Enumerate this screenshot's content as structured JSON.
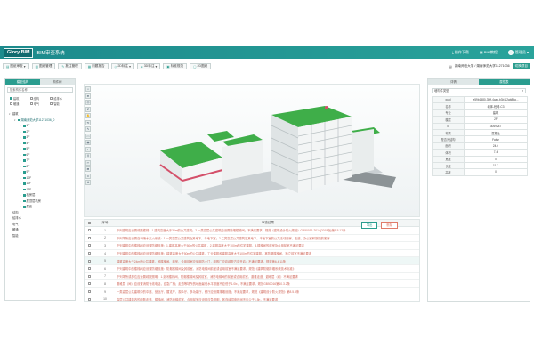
{
  "header": {
    "logo": "Glory BIM",
    "app_name": "BIM审查系统",
    "right_items": [
      "操作下载",
      "BIM教程"
    ],
    "user": "管理员"
  },
  "toolbar": {
    "buttons": [
      {
        "label": "图纸审查",
        "icon": "doc-icon"
      },
      {
        "label": "图纸管理",
        "icon": "folder-icon"
      },
      {
        "label": "批注管理",
        "icon": "note-icon"
      },
      {
        "label": "问题报告",
        "icon": "report-icon"
      },
      {
        "label": "2D标注",
        "icon": "mark-icon"
      },
      {
        "label": "3D标注",
        "icon": "cube-icon"
      },
      {
        "label": "标准规范",
        "icon": "book-icon"
      },
      {
        "label": "2D图纸",
        "icon": "sheet-icon"
      }
    ],
    "project_name": "湖南师范大学 / 湖南师范大学11271036",
    "switch_label": "切换项目"
  },
  "left_panel": {
    "tabs": [
      "模型结构",
      "构件树"
    ],
    "search_placeholder": "搜索构件名称",
    "filters": [
      "建筑",
      "结构",
      "给排水",
      "暖通",
      "电气",
      "智能"
    ],
    "tree": [
      {
        "label": "建筑",
        "level": 0,
        "expand": "▾"
      },
      {
        "label": "湖南师范大学11271036_0",
        "level": 1,
        "expand": "▾",
        "selected": true
      },
      {
        "label": "1F",
        "level": 2,
        "expand": "▸"
      },
      {
        "label": "2F",
        "level": 2,
        "expand": "▸"
      },
      {
        "label": "3F",
        "level": 2,
        "expand": "▸"
      },
      {
        "label": "4F",
        "level": 2,
        "expand": "▸"
      },
      {
        "label": "5F",
        "level": 2,
        "expand": "▸"
      },
      {
        "label": "6F",
        "level": 2,
        "expand": "▸"
      },
      {
        "label": "7F",
        "level": 2,
        "expand": "▸"
      },
      {
        "label": "8F",
        "level": 2,
        "expand": "▸"
      },
      {
        "label": "9F",
        "level": 2,
        "expand": "▸"
      },
      {
        "label": "10F",
        "level": 2,
        "expand": "▸"
      },
      {
        "label": "11F",
        "level": 2,
        "expand": "▸"
      },
      {
        "label": "12F",
        "level": 2,
        "expand": "▸"
      },
      {
        "label": "机房层",
        "level": 2,
        "expand": "▸"
      },
      {
        "label": "屋顶层机房",
        "level": 2,
        "expand": "▸"
      },
      {
        "label": "屋面",
        "level": 2,
        "expand": "▸"
      },
      {
        "label": "结构",
        "level": 0,
        "expand": ""
      },
      {
        "label": "给排水",
        "level": 0,
        "expand": ""
      },
      {
        "label": "电气",
        "level": 0,
        "expand": ""
      },
      {
        "label": "暖通",
        "level": 0,
        "expand": ""
      },
      {
        "label": "智能",
        "level": 0,
        "expand": ""
      }
    ]
  },
  "viewport": {
    "tools": [
      "⌂",
      "⊕",
      "◎",
      "Z",
      "✋",
      "⟲",
      "✎",
      "▭",
      "▦",
      "◐",
      "⚲",
      "✂",
      "⊞",
      "≡",
      "⚙"
    ]
  },
  "issues": {
    "col_index": "序号",
    "col_desc": "审查结果",
    "btn_export": "导出",
    "btn_delete": "删除",
    "rows": [
      {
        "num": "1",
        "desc": "下列建筑应设置疏散楼梯：1.建筑高度大于32m的公共建筑；2.一类高层公共建筑应设置防烟楼梯间；不满足要求，规范《建筑设计防火规范》GB50016-2014(2018版)第5.5.12条",
        "hl": false
      },
      {
        "num": "2",
        "desc": "下列场所应设置自动喷水灭火系统：1.一类高层公共建筑及其地下、半地下室；2.二类高层公共建筑及其地下、半地下室的公共活动用房、走道、办公室和旅馆的客房",
        "hl": false
      },
      {
        "num": "3",
        "desc": "下列建筑中的楼梯间应设置防烟设施：1.建筑高度大于50m的公共建筑，2.建筑高度大于100m的住宅建筑，3.楼梯间的前室及合用前室不满足要求",
        "hl": false
      },
      {
        "num": "4",
        "desc": "下列建筑中的楼梯间应设置防烟设施：建筑高度大于50m的公共建筑、工业建筑和建筑高度大于100m的住宅建筑，其防烟楼梯间、独立前室不满足要求",
        "hl": false
      },
      {
        "num": "5",
        "desc": "建筑高度大于24m的公共建筑，其楼梯间、前室、合用前室应采用防火门，疏散门应向疏散方向开启；不满足要求，规范第6.4.11条",
        "hl": true
      },
      {
        "num": "6",
        "desc": "下列建筑中的楼梯间应设置防烟设施：防烟楼梯间及其前室、消防电梯间前室或合用前室不满足要求，规范《建筑防烟排烟系统技术标准》",
        "hl": false
      },
      {
        "num": "7",
        "desc": "下列场所或部位应设置疏散照明：1.封闭楼梯间、防烟楼梯间及其前室、消防电梯间的前室或合用前室、避难走道、避难层（间）不满足要求",
        "hl": false
      },
      {
        "num": "8",
        "desc": "避难层（间）应设置消防专线电话，应急广播；走道等场所的地面最低水平照度不应低于1.0lx，不满足要求，规范GB50016第10.3.2条",
        "hl": false
      },
      {
        "num": "9",
        "desc": "一类高层公共建筑中的中庭、营业厅、展览厅、观众厅、多功能厅、餐厅应设置排烟设施；不满足要求，规范《建筑设计防火规范》第8.5.3条",
        "hl": false
      },
      {
        "num": "10",
        "desc": "高层公共建筑内的疏散走道、楼梯间、消防电梯前室、合用前室应设置应急照明，其连续供电时间不应少于1.5h，不满足要求",
        "hl": false
      },
      {
        "num": "11",
        "desc": "公共建筑内每个防火分区或一个防火分区的每个楼层，其安全出口的数量应经计算确定，且不应少于2个；不满足要求，规范第5.5.8条",
        "hl": false
      }
    ]
  },
  "right_panel": {
    "tabs": [
      "详情",
      "属性表"
    ],
    "select_value": "墙构件类型",
    "properties": [
      {
        "key": "guid",
        "value": "e59b1580-35ff-4cae-b3b1-2ab8ba..."
      },
      {
        "key": "名称",
        "value": "墙体-砼墙-C3"
      },
      {
        "key": "专业",
        "value": "建筑"
      },
      {
        "key": "楼层",
        "value": "2F"
      },
      {
        "key": "id",
        "value": "3069287"
      },
      {
        "key": "材质",
        "value": "混凝土"
      },
      {
        "key": "是否为结构",
        "value": "False"
      },
      {
        "key": "面积",
        "value": "24.6"
      },
      {
        "key": "体积",
        "value": "7.4"
      },
      {
        "key": "宽度",
        "value": "0"
      },
      {
        "key": "长度",
        "value": "11.2"
      },
      {
        "key": "高度",
        "value": "0"
      }
    ]
  }
}
